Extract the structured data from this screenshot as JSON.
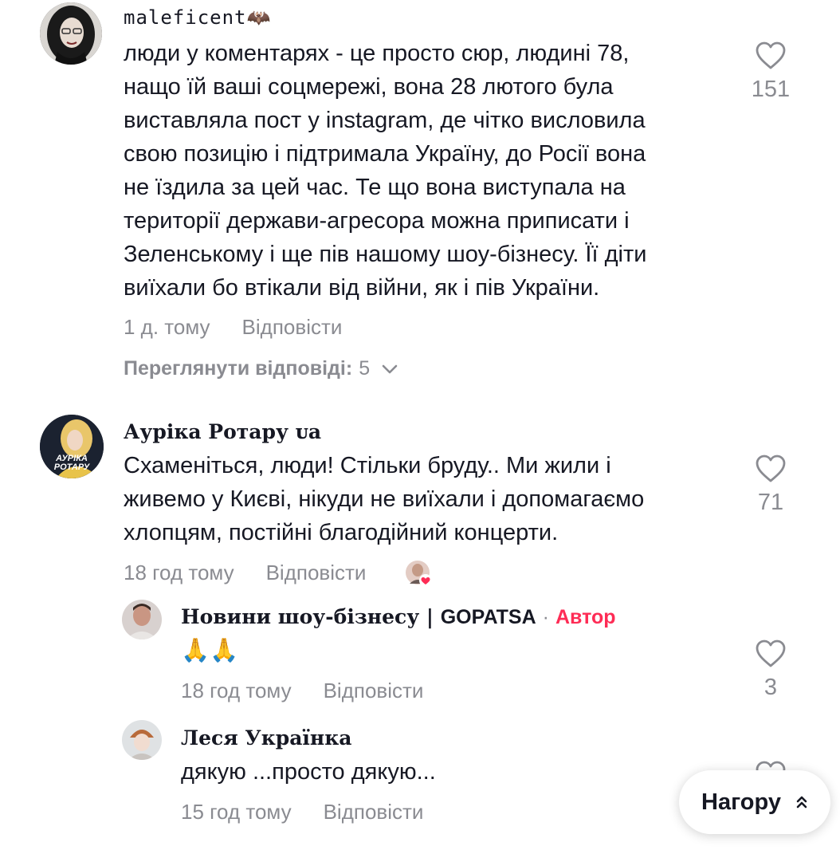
{
  "comments": [
    {
      "username": "maleficent🦇",
      "text": "люди у коментарях - це просто сюр, людині 78,\nнащо їй ваші соцмережі, вона 28 лютого була\nвиставляла пост у instagram, де чітко висловила\nсвою позицію і підтримала Україну, до Росії вона\nне їздила за цей час. Те що вона виступала на\nтериторії держави-агресора можна приписати і\nЗеленському і ще пів нашому шоу-бізнесу. Її діти\nвиїхали бо втікали від війни, як і пів України.",
      "time": "1 д. тому",
      "reply_label": "Відповісти",
      "likes": "151",
      "view_replies_label": "Переглянути відповіді:",
      "view_replies_count": "5"
    },
    {
      "username": "Аурiка Ротару ᴜa",
      "avatar_text_line1": "АУРІКА",
      "avatar_text_line2": "РОТАРУ",
      "text": "Схаменіться, люди! Стільки бруду.. Ми жили і\nживемо у Києві, нікуди не виїхали і допомагаємо\nхлопцям, постійні благодійний концерти.",
      "time": "18 год тому",
      "reply_label": "Відповісти",
      "likes": "71"
    }
  ],
  "replies": [
    {
      "username": "Новини шоу-бізнесу | ",
      "username_suffix": "GOPATSA",
      "separator": "·",
      "author_tag": "Автор",
      "text": "🙏🙏",
      "time": "18 год тому",
      "reply_label": "Відповісти",
      "likes": "3"
    },
    {
      "username": "Леся Українка",
      "text": "дякую ...просто дякую...",
      "time": "15 год тому",
      "reply_label": "Відповісти"
    }
  ],
  "to_top_label": "Нагору",
  "colors": {
    "text": "#161823",
    "muted": "#8a8b91",
    "accent": "#fe2c55"
  }
}
